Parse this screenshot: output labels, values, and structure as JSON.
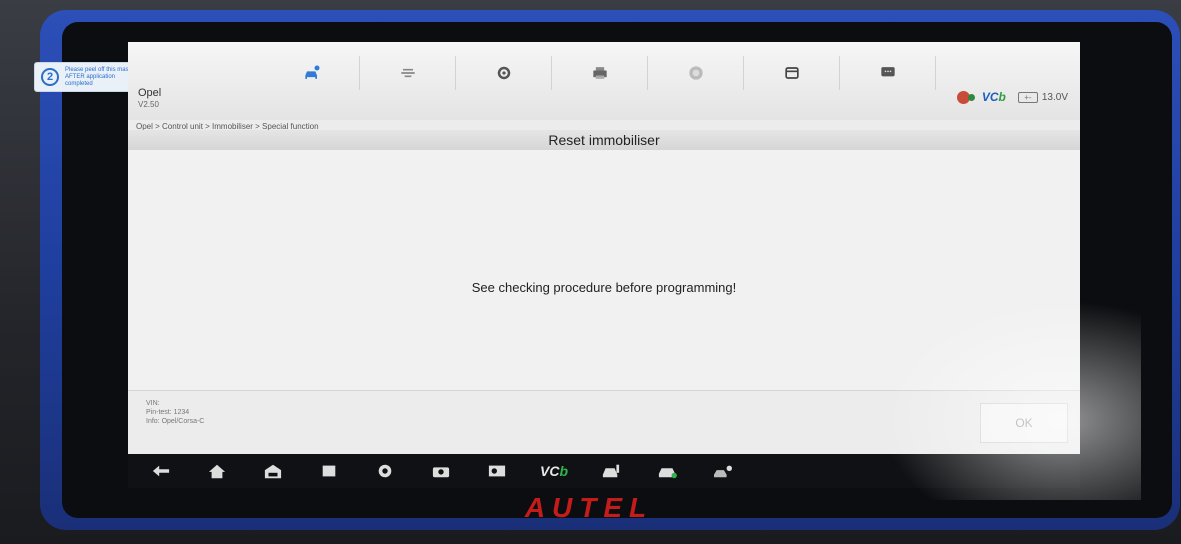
{
  "sticker": {
    "number": "2",
    "text": "Please peel off this mask AFTER application completed"
  },
  "vehicle": {
    "make": "Opel",
    "version": "V2.50"
  },
  "toolbar": {
    "tabs": [
      {
        "name": "car-home-icon"
      },
      {
        "name": "cable-icon"
      },
      {
        "name": "gear-icon"
      },
      {
        "name": "printer-icon"
      },
      {
        "name": "help-icon"
      },
      {
        "name": "save-icon"
      },
      {
        "name": "message-icon"
      }
    ]
  },
  "status": {
    "vci": "VC",
    "vci_b": "b",
    "battery_label": "13.0V"
  },
  "breadcrumb": "Opel > Control unit > Immobiliser > Special function",
  "page_title": "Reset immobiliser",
  "message": "See checking procedure before programming!",
  "info": {
    "vin": "VIN:",
    "pin": "Pin-test: 1234",
    "model": "Info: Opel/Corsa-C"
  },
  "ok_label": "OK",
  "navbar": {
    "vci": "VC",
    "vci_b": "b"
  },
  "logo": "AUTEL",
  "colors": {
    "accent": "#2f7bd6",
    "bezel": "#2c4fb8",
    "logo": "#c41b1b"
  }
}
